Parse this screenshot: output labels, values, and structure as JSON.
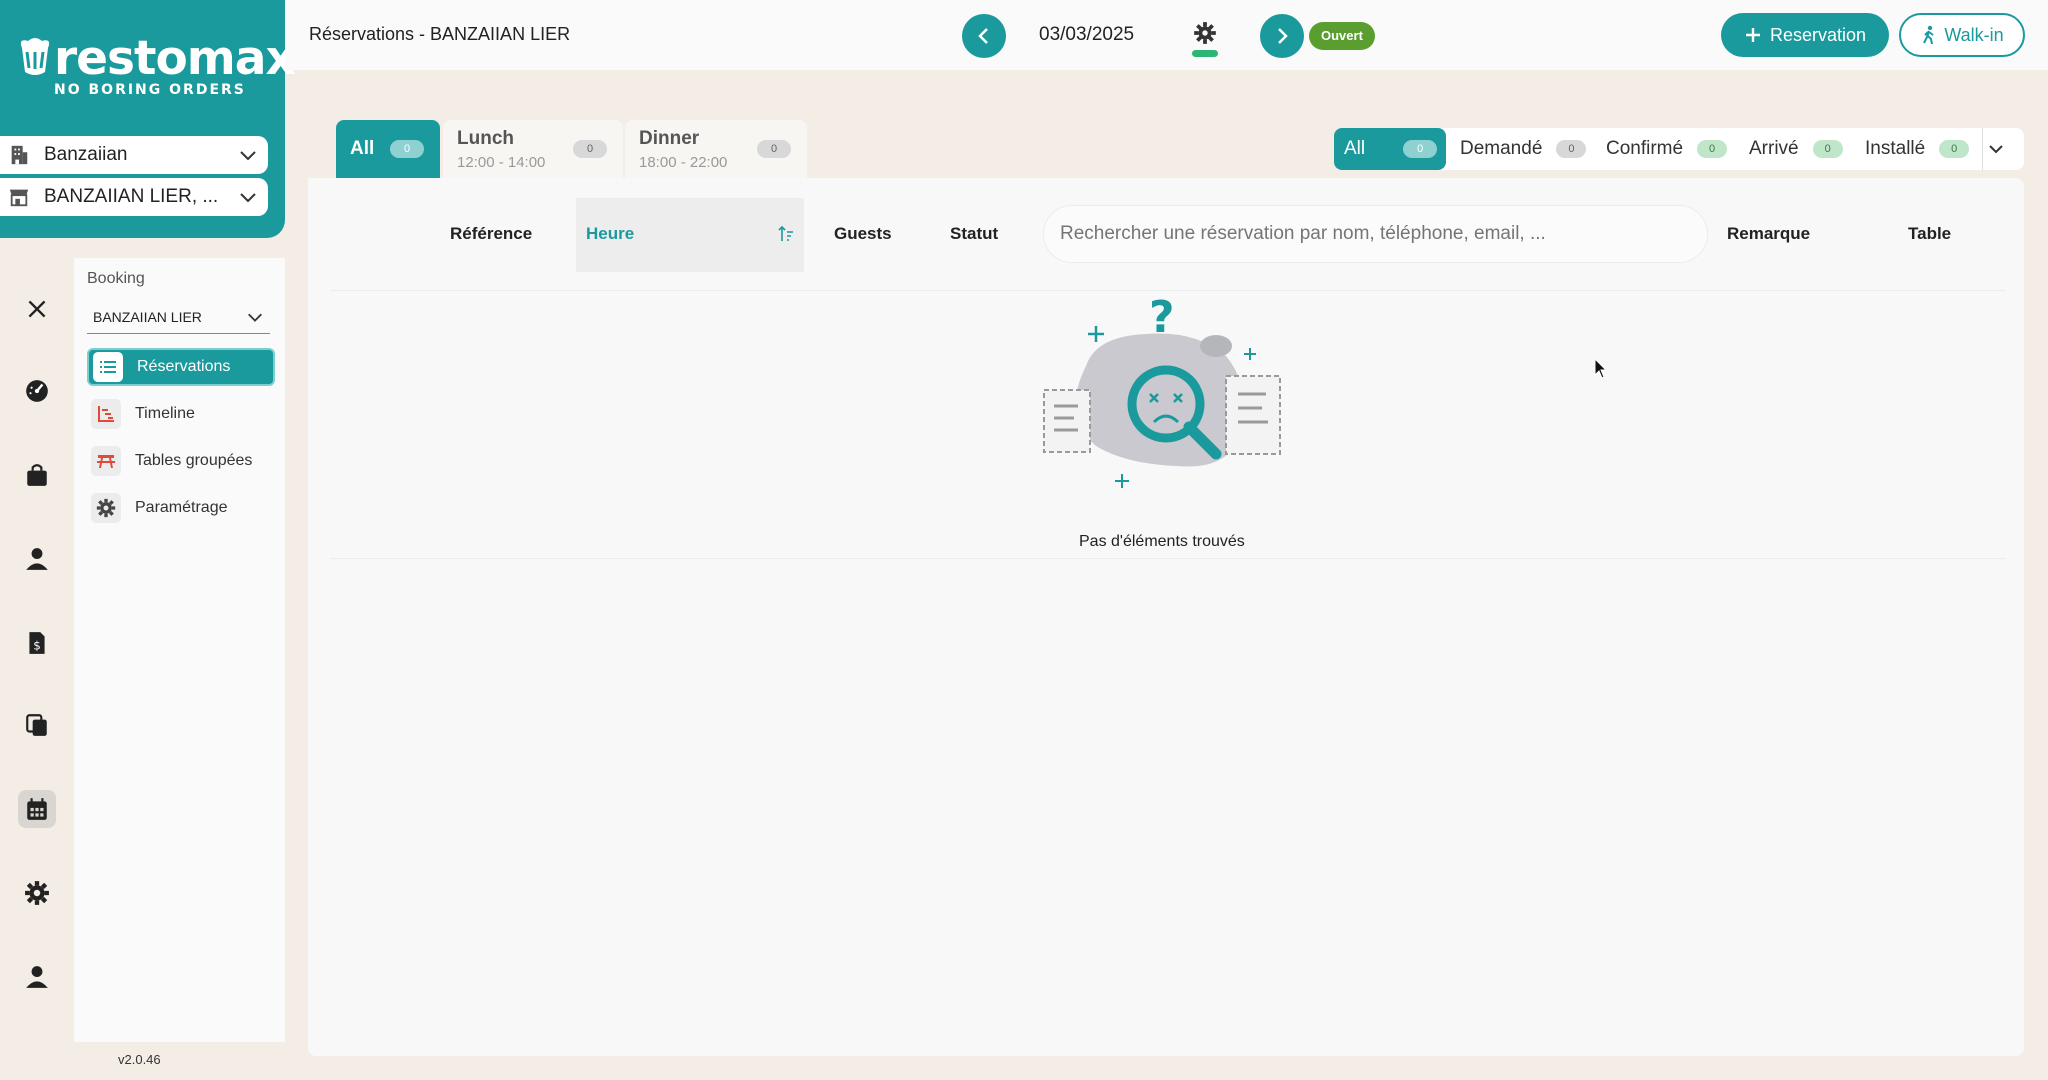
{
  "brand": {
    "name": "restomax",
    "tagline": "NO BORING ORDERS"
  },
  "location_selects": [
    {
      "label": "Banzaiian",
      "icon": "building-icon"
    },
    {
      "label": "BANZAIIAN LIER, ...",
      "icon": "store-icon"
    }
  ],
  "rail": [
    "close-icon",
    "dashboard-icon",
    "bag-icon",
    "user-icon",
    "invoice-icon",
    "copy-icon",
    "calendar-icon",
    "gear-icon",
    "profile-icon"
  ],
  "submenu": {
    "heading": "Booking",
    "dropdown_value": "BANZAIIAN LIER",
    "items": [
      {
        "label": "Réservations",
        "icon": "list-icon",
        "active": true
      },
      {
        "label": "Timeline",
        "icon": "timeline-icon",
        "active": false
      },
      {
        "label": "Tables groupées",
        "icon": "picnic-table-icon",
        "active": false
      },
      {
        "label": "Paramétrage",
        "icon": "gear-icon",
        "active": false
      }
    ]
  },
  "version": "v2.0.46",
  "topbar": {
    "title": "Réservations - BANZAIIAN LIER",
    "date": "03/03/2025",
    "status": "Ouvert",
    "reservation_label": "Reservation",
    "walkin_label": "Walk-in"
  },
  "service_tabs": [
    {
      "name": "All",
      "time": "",
      "count": "0"
    },
    {
      "name": "Lunch",
      "time": "12:00 - 14:00",
      "count": "0"
    },
    {
      "name": "Dinner",
      "time": "18:00 - 22:00",
      "count": "0"
    }
  ],
  "status_filters": [
    {
      "label": "All",
      "count": "0"
    },
    {
      "label": "Demandé",
      "count": "0"
    },
    {
      "label": "Confirmé",
      "count": "0"
    },
    {
      "label": "Arrivé",
      "count": "0"
    },
    {
      "label": "Installé",
      "count": "0"
    }
  ],
  "table": {
    "columns": {
      "reference": "Référence",
      "heure": "Heure",
      "guests": "Guests",
      "statut": "Statut",
      "remarque": "Remarque",
      "table": "Table"
    },
    "search_placeholder": "Rechercher une réservation par nom, téléphone, email, ..."
  },
  "empty_state": "Pas d'éléments trouvés",
  "colors": {
    "accent": "#1a9a9c",
    "open_status": "#5a9e2f",
    "background": "#f3ede6"
  }
}
